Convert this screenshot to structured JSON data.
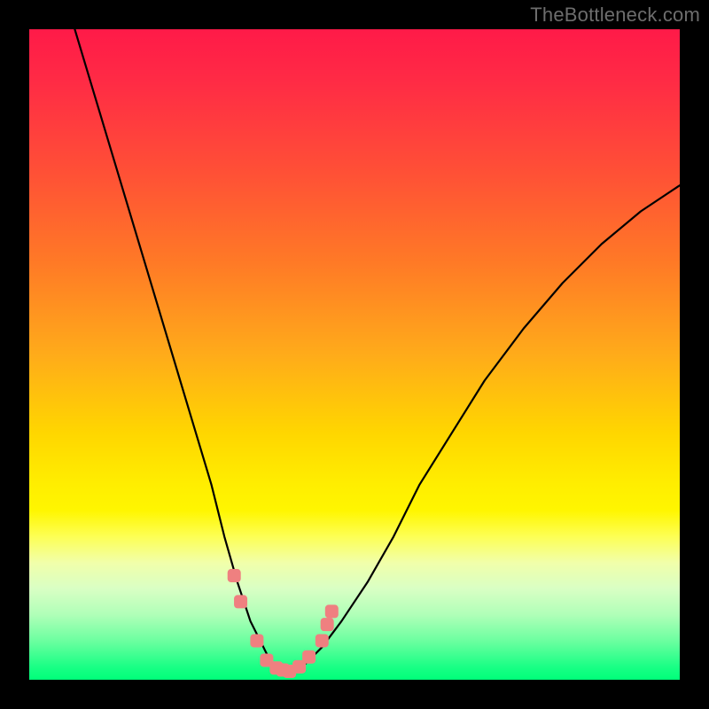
{
  "watermark": "TheBottleneck.com",
  "chart_data": {
    "type": "line",
    "title": "",
    "xlabel": "",
    "ylabel": "",
    "xlim": [
      0,
      100
    ],
    "ylim": [
      0,
      100
    ],
    "grid": false,
    "series": [
      {
        "name": "bottleneck-curve",
        "color": "#000000",
        "x": [
          7,
          10,
          13,
          16,
          19,
          22,
          25,
          28,
          30,
          32,
          34,
          36,
          37,
          38,
          39,
          40,
          41,
          42,
          43,
          45,
          48,
          52,
          56,
          60,
          65,
          70,
          76,
          82,
          88,
          94,
          100
        ],
        "y": [
          100,
          90,
          80,
          70,
          60,
          50,
          40,
          30,
          22,
          15,
          9,
          5,
          3,
          2,
          1.5,
          1.2,
          1.5,
          2,
          3,
          5,
          9,
          15,
          22,
          30,
          38,
          46,
          54,
          61,
          67,
          72,
          76
        ]
      }
    ],
    "markers": {
      "name": "optimum-markers",
      "shape": "rounded-square",
      "color": "#ef8080",
      "points_xy": [
        [
          31.5,
          16
        ],
        [
          32.5,
          12
        ],
        [
          35,
          6
        ],
        [
          36.5,
          3
        ],
        [
          38,
          1.8
        ],
        [
          39,
          1.5
        ],
        [
          40,
          1.3
        ],
        [
          41.5,
          2
        ],
        [
          43,
          3.5
        ],
        [
          45,
          6
        ],
        [
          45.8,
          8.5
        ],
        [
          46.5,
          10.5
        ]
      ]
    },
    "gradient_stops": [
      {
        "pos": 0.0,
        "color": "#ff1a48"
      },
      {
        "pos": 0.08,
        "color": "#ff2b45"
      },
      {
        "pos": 0.22,
        "color": "#ff5036"
      },
      {
        "pos": 0.36,
        "color": "#ff7a26"
      },
      {
        "pos": 0.5,
        "color": "#ffab1a"
      },
      {
        "pos": 0.62,
        "color": "#ffd600"
      },
      {
        "pos": 0.7,
        "color": "#ffee00"
      },
      {
        "pos": 0.74,
        "color": "#fff600"
      },
      {
        "pos": 0.78,
        "color": "#fdff55"
      },
      {
        "pos": 0.82,
        "color": "#f1ffaa"
      },
      {
        "pos": 0.86,
        "color": "#d9ffc4"
      },
      {
        "pos": 0.9,
        "color": "#b0ffb8"
      },
      {
        "pos": 0.94,
        "color": "#6cffa0"
      },
      {
        "pos": 0.98,
        "color": "#1aff85"
      },
      {
        "pos": 1.0,
        "color": "#00ff7a"
      }
    ]
  }
}
